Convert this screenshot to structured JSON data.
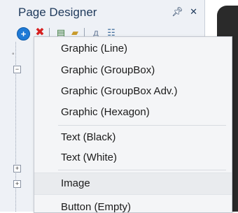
{
  "pane": {
    "title": "Page Designer",
    "pin_glyph": " 1",
    "close_glyph": "×"
  },
  "toolbar": {
    "add_icon": "add-icon",
    "delete_icon": "delete-icon"
  },
  "menu": {
    "groups": [
      [
        "Graphic (Line)",
        "Graphic (GroupBox)",
        "Graphic (GroupBox Adv.)",
        "Graphic (Hexagon)"
      ],
      [
        "Text (Black)",
        "Text (White)"
      ],
      [
        "Image",
        "Button (Empty)"
      ]
    ],
    "highlighted": "Image",
    "items": {
      "graphic_line": "Graphic (Line)",
      "graphic_groupbox": "Graphic (GroupBox)",
      "graphic_groupbox_adv": "Graphic (GroupBox Adv.)",
      "graphic_hexagon": "Graphic (Hexagon)",
      "text_black": "Text (Black)",
      "text_white": "Text (White)",
      "image": "Image",
      "button_empty": "Button (Empty)"
    }
  },
  "colors": {
    "pane_bg": "#eef1f6",
    "menu_bg": "#f4f5f7",
    "title_text": "#1e395b",
    "highlight": "#e9ebee"
  }
}
